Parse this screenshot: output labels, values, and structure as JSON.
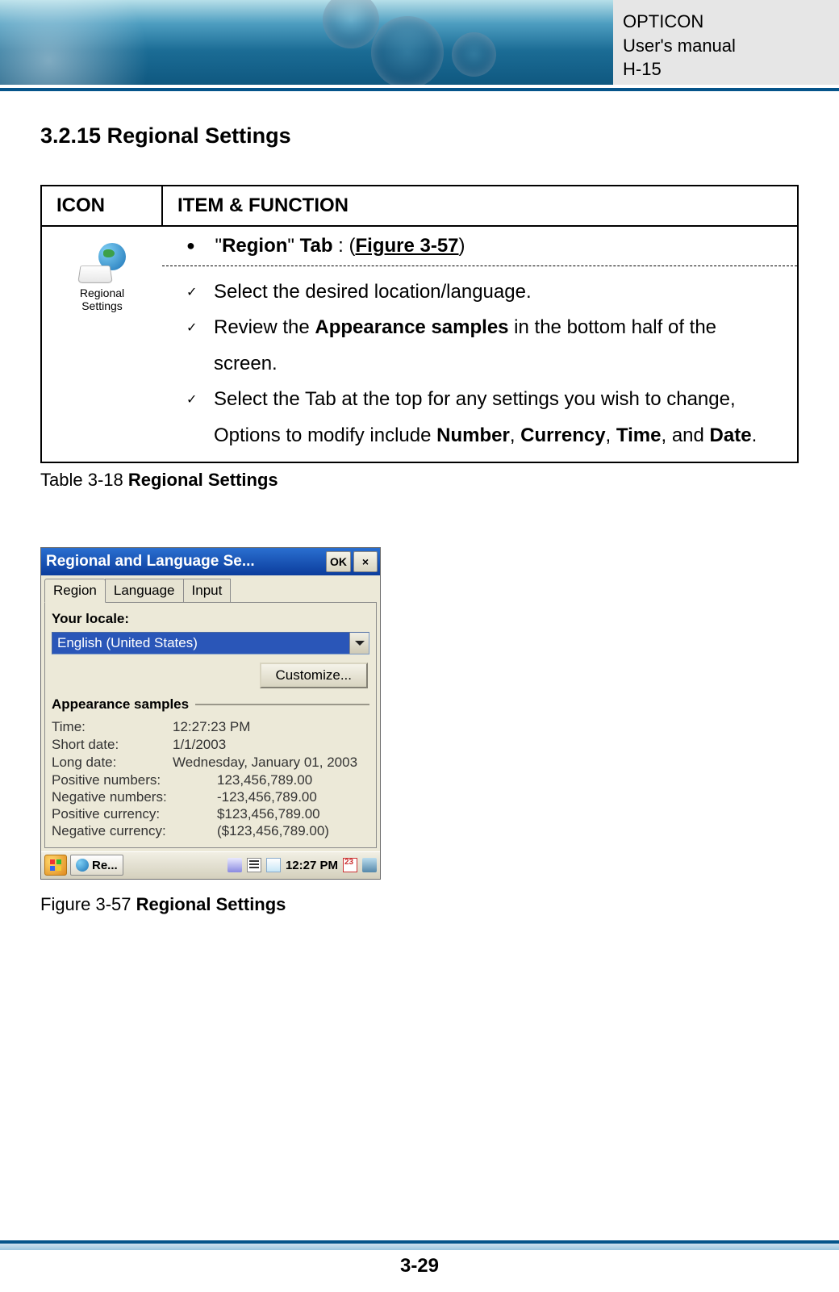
{
  "header": {
    "brand": "OPTICON",
    "doc": "User's manual",
    "model": "H-15"
  },
  "section_heading": "3.2.15 Regional Settings",
  "table": {
    "col_icon": "ICON",
    "col_func": "ITEM & FUNCTION",
    "icon_caption_l1": "Regional",
    "icon_caption_l2": "Settings",
    "tab_line_pre_quote": "\"",
    "tab_line_region": "Region",
    "tab_line_post_quote": "\" ",
    "tab_line_tab": "Tab",
    "tab_line_colon": " : (",
    "tab_line_fig": "Figure 3-57",
    "tab_line_close": ")",
    "items": [
      "Select the desired location/language.",
      "Review the <b>Appearance samples</b> in the bottom half of the screen.",
      "Select the Tab at the top for any settings you wish to change, Options to modify include <b>Number</b>, <b>Currency</b>, <b>Time</b>, and <b>Date</b>."
    ]
  },
  "table_caption_pre": "Table 3-18 ",
  "table_caption_bold": "Regional Settings",
  "dialog": {
    "title": "Regional and Language Se...",
    "ok": "OK",
    "close": "×",
    "tabs": [
      "Region",
      "Language",
      "Input"
    ],
    "locale_label": "Your locale:",
    "locale_value": "English (United States)",
    "customize": "Customize...",
    "group_label": "Appearance samples",
    "samples1": [
      {
        "l": "Time:",
        "v": "12:27:23 PM"
      },
      {
        "l": "Short date:",
        "v": "1/1/2003"
      },
      {
        "l": "Long date:",
        "v": "Wednesday, January 01, 2003"
      }
    ],
    "samples2": [
      {
        "l": "Positive numbers:",
        "v": "123,456,789.00"
      },
      {
        "l": "Negative numbers:",
        "v": "-123,456,789.00"
      },
      {
        "l": "Positive currency:",
        "v": "$123,456,789.00"
      },
      {
        "l": "Negative currency:",
        "v": "($123,456,789.00)"
      }
    ],
    "taskbar_task": "Re...",
    "taskbar_time": "12:27 PM"
  },
  "figure_caption_pre": "Figure 3-57 ",
  "figure_caption_bold": "Regional Settings",
  "page_number": "3-29"
}
